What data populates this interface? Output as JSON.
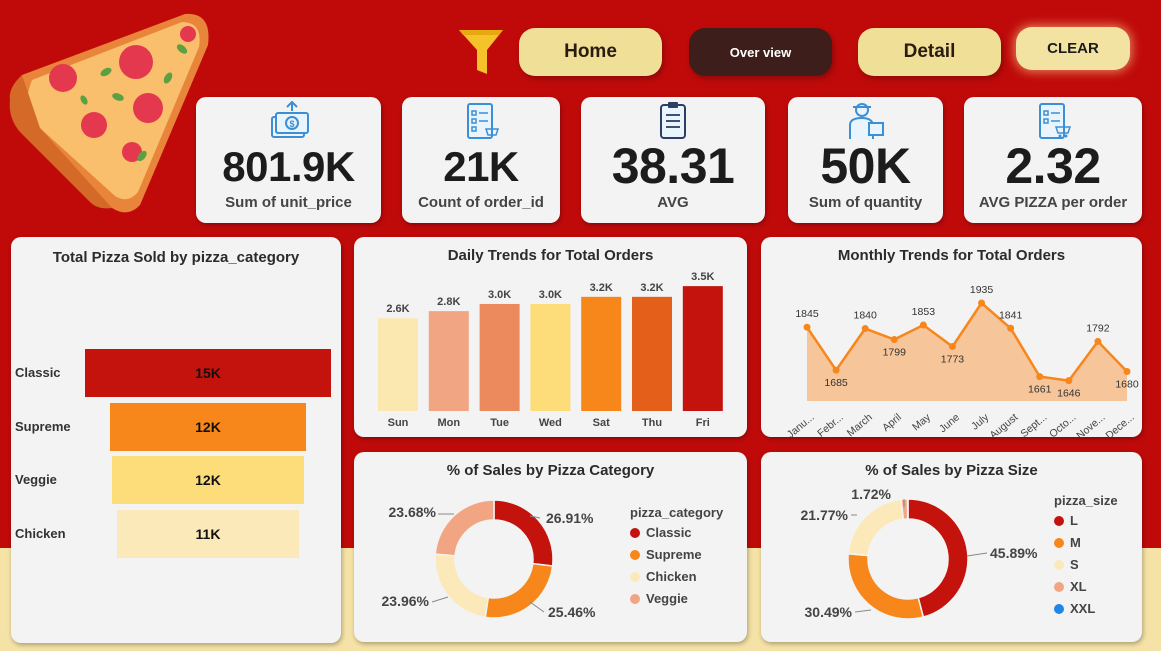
{
  "nav": {
    "home_label": "Home",
    "overview_label": "Over view",
    "detail_label": "Detail",
    "clear_label": "CLEAR"
  },
  "kpis": [
    {
      "value": "801.9K",
      "label": "Sum of unit_price",
      "icon": "money-icon"
    },
    {
      "value": "21K",
      "label": "Count of order_id",
      "icon": "order-list-icon"
    },
    {
      "value": "38.31",
      "label": "AVG",
      "icon": "clipboard-icon"
    },
    {
      "value": "50K",
      "label": "Sum of quantity",
      "icon": "delivery-person-icon"
    },
    {
      "value": "2.32",
      "label": "AVG PIZZA per order",
      "icon": "order-cart-icon"
    }
  ],
  "colors": {
    "background": "#c00a0a",
    "band": "#f5e2a6",
    "dark_red": "#c4120c",
    "orange": "#f7861b",
    "light_orange": "#f1a583",
    "yellow": "#fddd7a",
    "cream": "#fce9ba"
  },
  "category_panel": {
    "title": "Total Pizza Sold by pizza_category",
    "items": [
      {
        "label": "Classic",
        "value_label": "15K",
        "value": 15000,
        "color": "#c4120c"
      },
      {
        "label": "Supreme",
        "value_label": "12K",
        "value": 11987,
        "color": "#f7861b"
      },
      {
        "label": "Veggie",
        "value_label": "12K",
        "value": 11649,
        "color": "#fddd7a"
      },
      {
        "label": "Chicken",
        "value_label": "11K",
        "value": 11050,
        "color": "#fce9ba"
      }
    ]
  },
  "daily_panel": {
    "title": "Daily Trends for Total Orders"
  },
  "monthly_panel": {
    "title": "Monthly Trends for Total Orders"
  },
  "category_pct_panel": {
    "title": "% of Sales by Pizza Category",
    "legend_title": "pizza_category"
  },
  "size_pct_panel": {
    "title": "% of Sales by Pizza Size",
    "legend_title": "pizza_size"
  },
  "chart_data": [
    {
      "type": "bar",
      "title": "Total Pizza Sold by pizza_category",
      "orientation": "horizontal",
      "categories": [
        "Classic",
        "Supreme",
        "Veggie",
        "Chicken"
      ],
      "values": [
        15000,
        12000,
        12000,
        11000
      ],
      "data_labels": [
        "15K",
        "12K",
        "12K",
        "11K"
      ]
    },
    {
      "type": "bar",
      "title": "Daily Trends for Total Orders",
      "categories": [
        "Sun",
        "Mon",
        "Tue",
        "Wed",
        "Sat",
        "Thu",
        "Fri"
      ],
      "values": [
        2600,
        2800,
        3000,
        3000,
        3200,
        3200,
        3500
      ],
      "data_labels": [
        "2.6K",
        "2.8K",
        "3.0K",
        "3.0K",
        "3.2K",
        "3.2K",
        "3.5K"
      ],
      "colors": [
        "#fbe7b0",
        "#f1a583",
        "#ec8a5e",
        "#fddd7a",
        "#f7861b",
        "#e4601a",
        "#c4120c"
      ]
    },
    {
      "type": "area",
      "title": "Monthly Trends for Total Orders",
      "categories": [
        "Janu...",
        "Febr...",
        "March",
        "April",
        "May",
        "June",
        "July",
        "August",
        "Sept...",
        "Octo...",
        "Nove...",
        "Dece..."
      ],
      "values": [
        1845,
        1685,
        1840,
        1799,
        1853,
        1773,
        1935,
        1841,
        1661,
        1646,
        1792,
        1680
      ],
      "line_color": "#f7861b",
      "fill_color": "#f7c59a"
    },
    {
      "type": "pie",
      "title": "% of Sales by Pizza Category",
      "legend_title": "pizza_category",
      "legend_position": "right",
      "labels": [
        "Classic",
        "Supreme",
        "Chicken",
        "Veggie"
      ],
      "values": [
        26.91,
        25.46,
        23.96,
        23.68
      ],
      "data_labels": [
        "26.91%",
        "25.46%",
        "23.96%",
        "23.68%"
      ],
      "colors": [
        "#c4120c",
        "#f7861b",
        "#fce9ba",
        "#f1a583"
      ]
    },
    {
      "type": "pie",
      "title": "% of Sales by Pizza Size",
      "legend_title": "pizza_size",
      "legend_position": "right",
      "labels": [
        "L",
        "M",
        "S",
        "XL",
        "XXL"
      ],
      "values": [
        45.89,
        30.49,
        21.77,
        1.72,
        0.12
      ],
      "data_labels": [
        "45.89%",
        "30.49%",
        "21.77%",
        "1.72%",
        ""
      ],
      "colors": [
        "#c4120c",
        "#f7861b",
        "#fce9ba",
        "#f1a583",
        "#1e88e5"
      ]
    }
  ]
}
